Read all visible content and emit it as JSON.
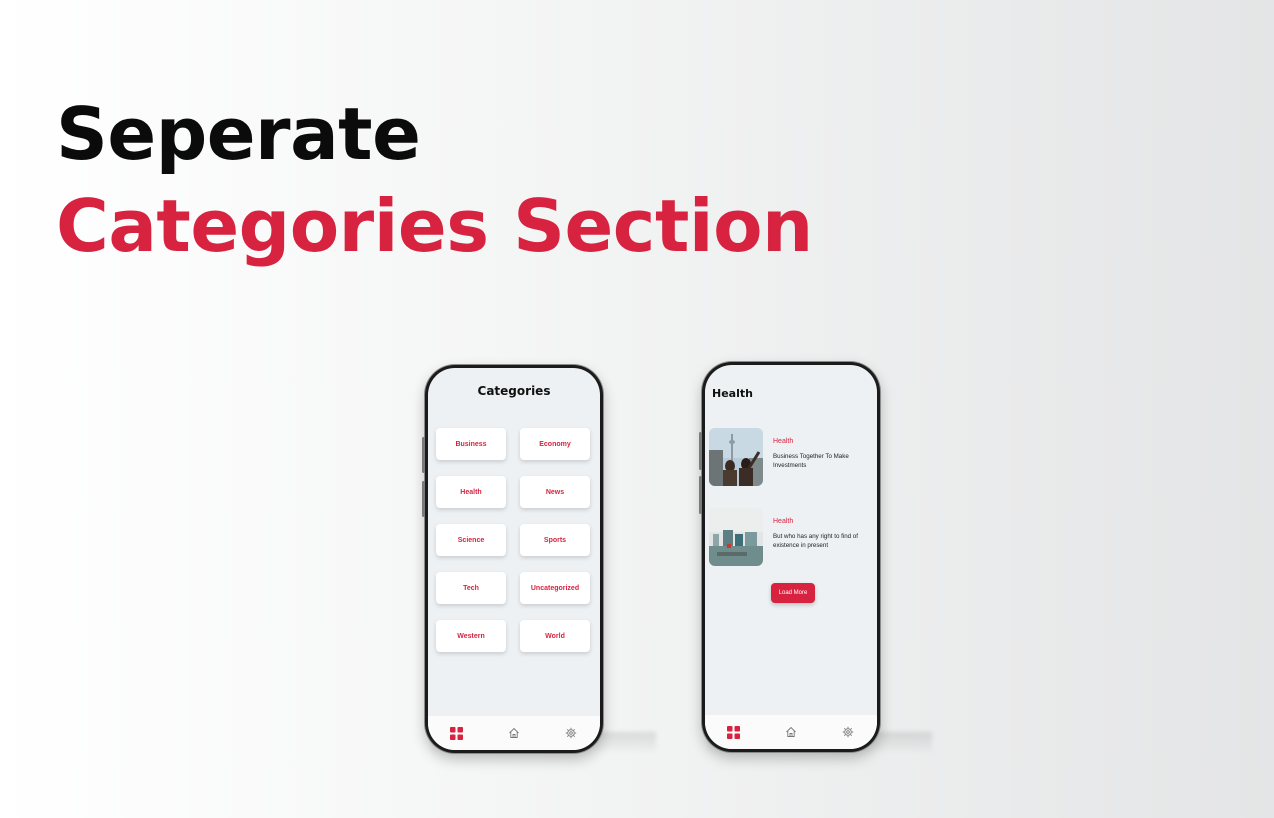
{
  "headline": {
    "line1": "Seperate",
    "line2": "Categories Section"
  },
  "colors": {
    "accent": "#d72340",
    "dark": "#0b0b0b"
  },
  "categories_screen": {
    "title": "Categories",
    "items": [
      "Business",
      "Economy",
      "Health",
      "News",
      "Science",
      "Sports",
      "Tech",
      "Uncategorized",
      "Western",
      "World"
    ]
  },
  "health_screen": {
    "title": "Health",
    "articles": [
      {
        "category": "Health",
        "title": "Business Together To Make Investments",
        "image": "people-city-tower-photo"
      },
      {
        "category": "Health",
        "title": "But who has any right to find of existence in present",
        "image": "harbor-city-photo"
      }
    ],
    "load_more": "Load More"
  },
  "nav": {
    "items": [
      "grid-icon",
      "home-icon",
      "gear-icon"
    ],
    "active": "grid-icon"
  }
}
